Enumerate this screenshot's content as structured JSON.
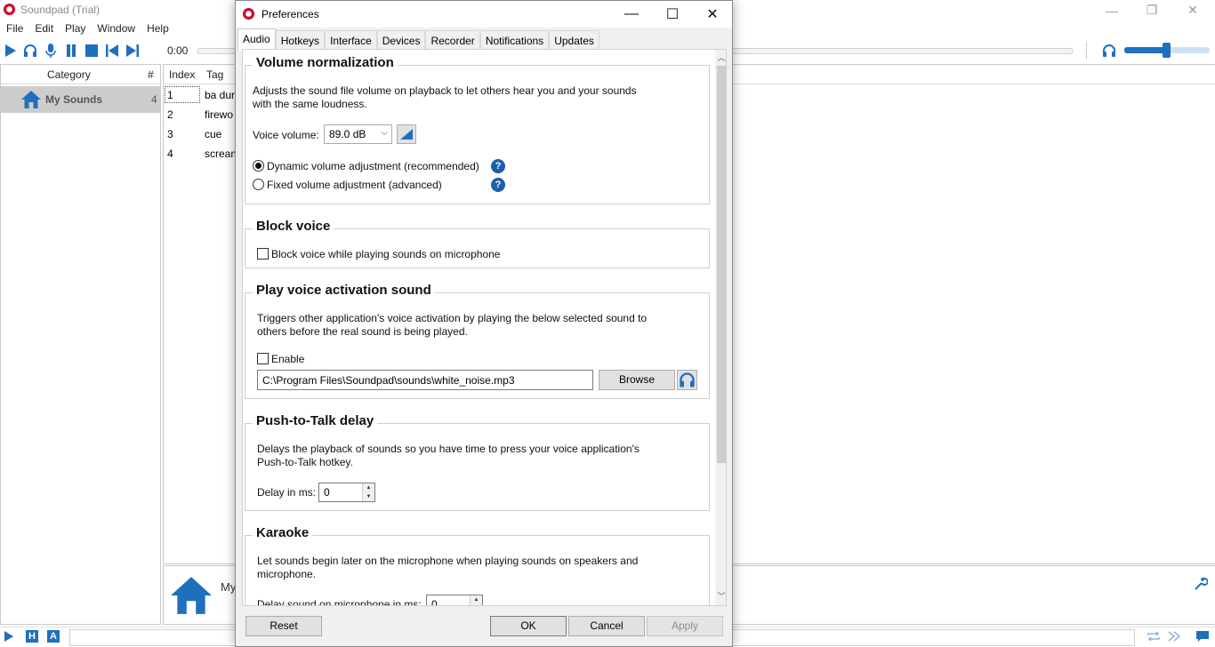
{
  "app": {
    "title": "Soundpad (Trial)",
    "menu": [
      "File",
      "Edit",
      "Play",
      "Window",
      "Help"
    ],
    "time": "0:00",
    "volume_fraction": 0.5,
    "category_header": {
      "name": "Category",
      "count": "#"
    },
    "categories": [
      {
        "label": "My Sounds",
        "count": "4"
      }
    ],
    "list_headers": {
      "index": "Index",
      "tag": "Tag"
    },
    "sounds": [
      {
        "index": "1",
        "tag": "ba dur"
      },
      {
        "index": "2",
        "tag": "firewo"
      },
      {
        "index": "3",
        "tag": "cue"
      },
      {
        "index": "4",
        "tag": "scream"
      }
    ],
    "bottom_title": "My",
    "status_buttons": [
      "H",
      "A"
    ],
    "accent": "#1f6fbf"
  },
  "dialog": {
    "title": "Preferences",
    "tabs": [
      "Audio",
      "Hotkeys",
      "Interface",
      "Devices",
      "Recorder",
      "Notifications",
      "Updates"
    ],
    "active_tab": "Audio",
    "volume_normalization": {
      "title": "Volume normalization",
      "description_line1": "Adjusts the sound file volume on playback to let others hear you and your sounds",
      "description_line2": "with the same loudness.",
      "voice_volume_label": "Voice volume:",
      "voice_volume_value": "89.0 dB",
      "dynamic_label": "Dynamic volume adjustment (recommended)",
      "fixed_label": "Fixed volume adjustment (advanced)",
      "help": "?"
    },
    "block_voice": {
      "title": "Block voice",
      "checkbox_label": "Block voice while playing sounds on microphone"
    },
    "voice_activation": {
      "title": "Play voice activation sound",
      "description_line1": "Triggers other application's voice activation by playing the below selected sound to",
      "description_line2": "others before the real sound is being played.",
      "enable_label": "Enable",
      "file_path": "C:\\Program Files\\Soundpad\\sounds\\white_noise.mp3",
      "browse_label": "Browse"
    },
    "push_to_talk": {
      "title": "Push-to-Talk delay",
      "description_line1": "Delays the playback of sounds so you have time to press your voice application's",
      "description_line2": "Push-to-Talk hotkey.",
      "delay_label": "Delay in ms:",
      "delay_value": "0"
    },
    "karaoke": {
      "title": "Karaoke",
      "description_line1": "Let sounds begin later on the microphone when playing sounds on speakers and",
      "description_line2": "microphone.",
      "delay_label": "Delay sound on microphone in ms:",
      "delay_value": "0"
    },
    "buttons": {
      "reset": "Reset",
      "ok": "OK",
      "cancel": "Cancel",
      "apply": "Apply"
    }
  }
}
